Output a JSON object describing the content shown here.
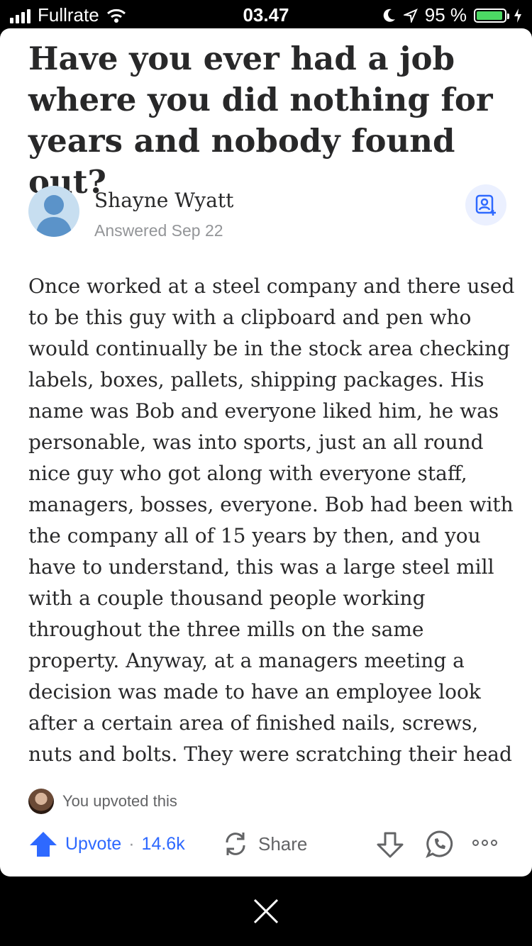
{
  "status_bar": {
    "carrier": "Fullrate",
    "time": "03.47",
    "battery_percent": "95 %",
    "signal_bars": 4,
    "battery_level": 0.95
  },
  "question": {
    "title": "Have you ever had a job where you did nothing for years and nobody found out?"
  },
  "author": {
    "name": "Shayne Wyatt",
    "answered": "Answered Sep 22"
  },
  "answer": {
    "lines": [
      "Once worked at a steel company and there used",
      "to be this guy with a clipboard and pen who",
      "would continually be in the stock area checking",
      "labels, boxes, pallets, shipping packages. His",
      "name was Bob and everyone liked him, he was",
      "personable, was into sports, just an all round",
      "nice guy who got along with everyone staff,",
      "managers, bosses, everyone. Bob had been with",
      "the company all of 15 years by then, and you",
      "have to understand, this was a large steel mill",
      "with a couple thousand people working",
      "throughout the three mills on the same",
      "property. Anyway, at a managers meeting a",
      "decision was made to have an employee look",
      "after a certain area of finished nails, screws,",
      "nuts and bolts. They were scratching their head"
    ]
  },
  "social": {
    "upvoted_text": "You upvoted this"
  },
  "actions": {
    "upvote_label": "Upvote",
    "separator": "·",
    "upvote_count": "14.6k",
    "share_label": "Share"
  },
  "colors": {
    "accent": "#2e69ff",
    "text": "#282829",
    "muted": "#939598",
    "battery": "#4cd964"
  },
  "icons": [
    "signal-icon",
    "wifi-icon",
    "moon-icon",
    "location-icon",
    "battery-icon",
    "charging-icon",
    "follow-icon",
    "upvote-arrow-icon",
    "share-icon",
    "downvote-icon",
    "whatsapp-icon",
    "more-icon",
    "close-icon"
  ]
}
